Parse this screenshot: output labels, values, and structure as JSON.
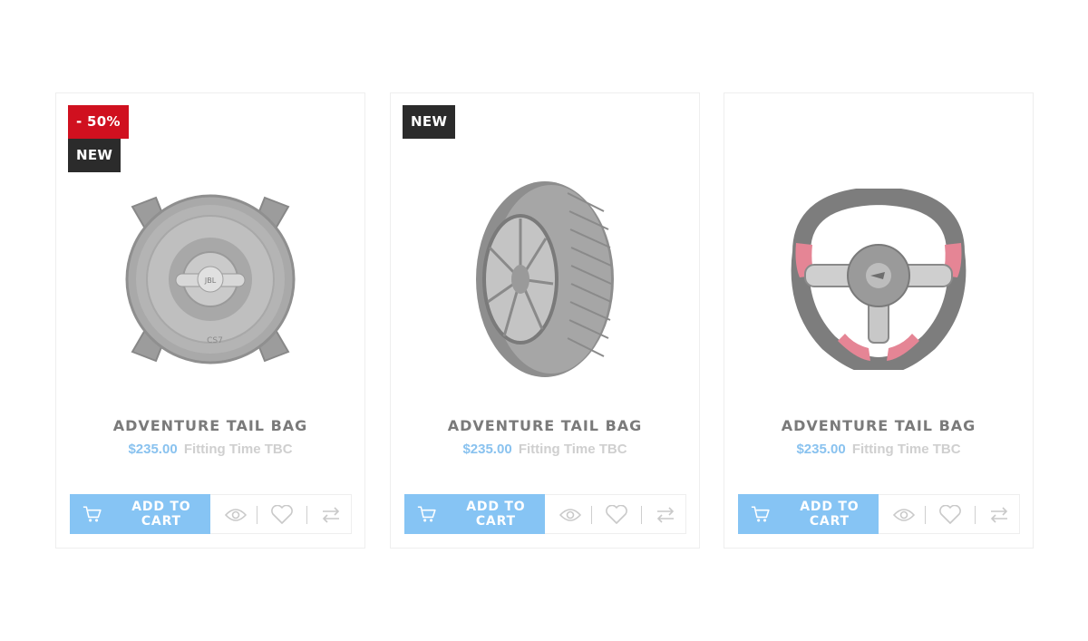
{
  "colors": {
    "sale_badge": "#d0101f",
    "new_badge": "#2b2b2b",
    "cart_button": "#86c4f4",
    "price": "#89c2ef",
    "fitting_text": "#cfcfcf",
    "title_text": "#7a7a7a"
  },
  "products": [
    {
      "badges": [
        "- 50%",
        "NEW"
      ],
      "image": "car-speaker",
      "title": "ADVENTURE TAIL BAG",
      "price": "$235.00",
      "fitting": "Fitting Time TBC",
      "add_to_cart": "ADD TO CART",
      "icons": [
        "cart-icon",
        "eye-icon",
        "heart-icon",
        "compare-icon"
      ]
    },
    {
      "badges": [
        "NEW"
      ],
      "image": "tire",
      "title": "ADVENTURE TAIL BAG",
      "price": "$235.00",
      "fitting": "Fitting Time TBC",
      "add_to_cart": "ADD TO CART",
      "icons": [
        "cart-icon",
        "eye-icon",
        "heart-icon",
        "compare-icon"
      ]
    },
    {
      "badges": [],
      "image": "steering-wheel",
      "title": "ADVENTURE TAIL BAG",
      "price": "$235.00",
      "fitting": "Fitting Time TBC",
      "add_to_cart": "ADD TO CART",
      "icons": [
        "cart-icon",
        "eye-icon",
        "heart-icon",
        "compare-icon"
      ]
    }
  ]
}
